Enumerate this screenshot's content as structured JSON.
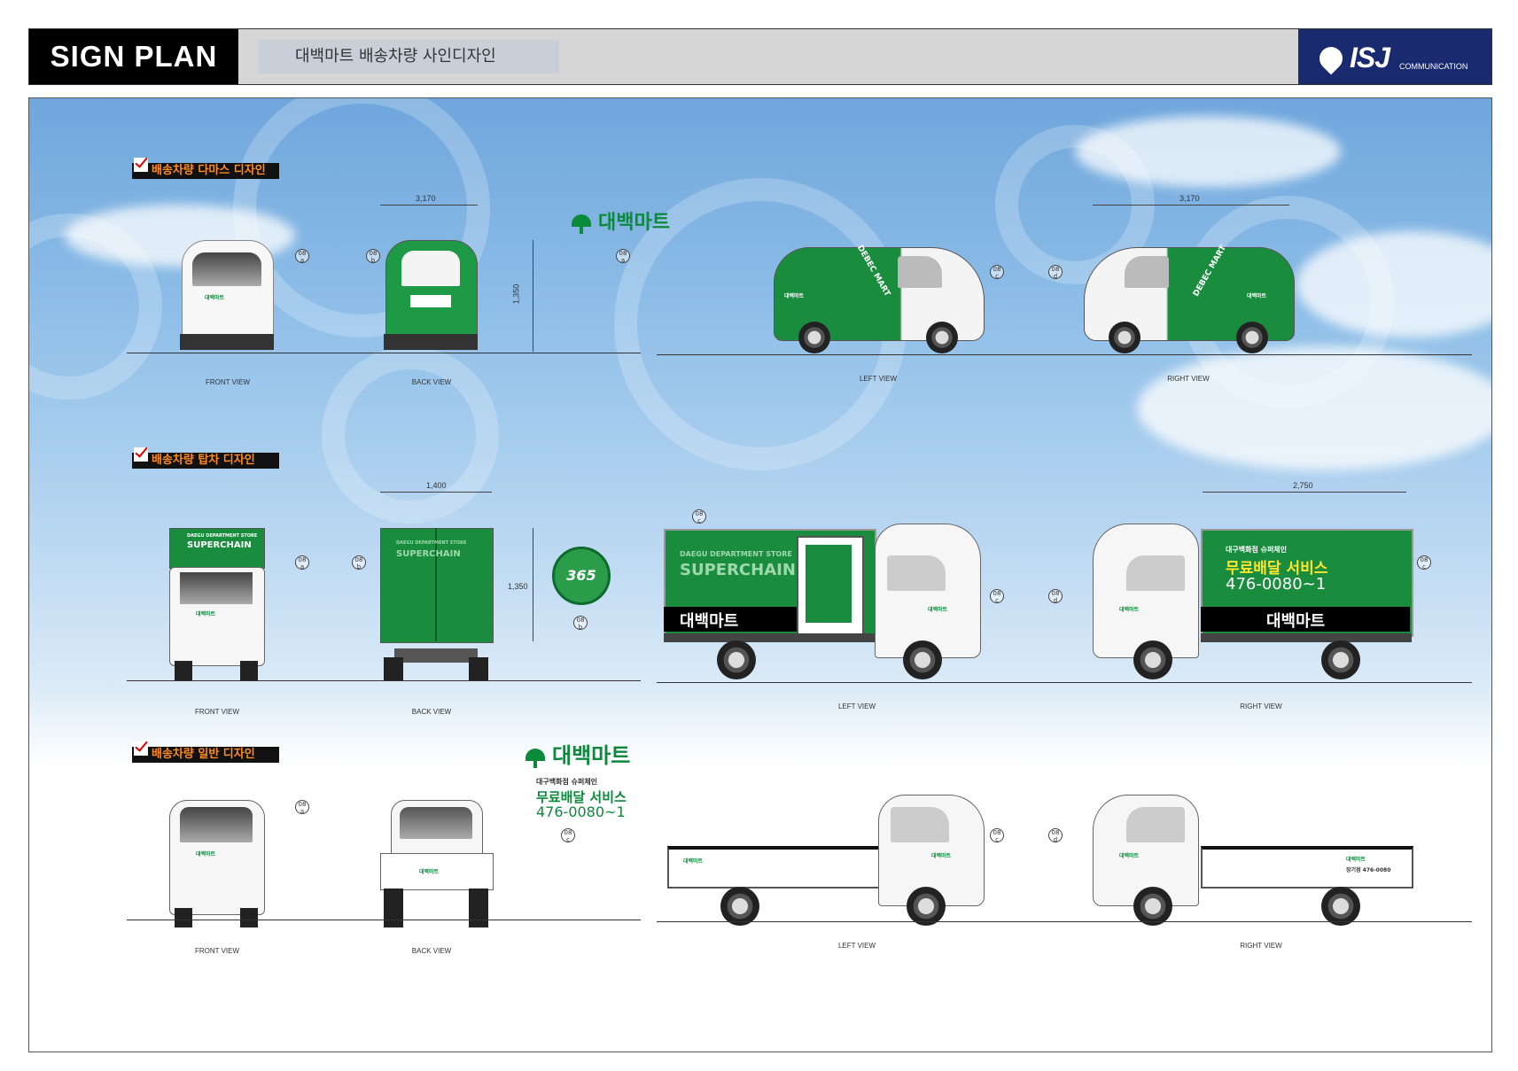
{
  "header": {
    "title": "SIGN PLAN",
    "subtitle": "대백마트 배송차량 사인디자인",
    "logo_text": "ISJ",
    "logo_sub": "COMMUNICATION",
    "logo_bg": "#1a2a6e"
  },
  "brand": {
    "name": "대백마트",
    "color": "#0b8a3c",
    "promo_small": "대구백화점 슈퍼체인",
    "promo_service": "무료배달 서비스",
    "promo_phone": "476-0080~1",
    "box_store": "DAEGU DEPARTMENT STORE",
    "box_chain": "SUPERCHAIN",
    "badge": "365",
    "van_side": "DEBEC MART",
    "truck_phone_small": "장기점 476-0080"
  },
  "sections": [
    {
      "heading": "배송차량 다마스 디자인",
      "views": [
        "FRONT VIEW",
        "BACK VIEW",
        "LEFT VIEW",
        "RIGHT VIEW"
      ],
      "dims": {
        "width_back": "3,170",
        "width_side": "3,170",
        "height": "1,350"
      }
    },
    {
      "heading": "배송차량 탑차 디자인",
      "views": [
        "FRONT VIEW",
        "BACK VIEW",
        "LEFT VIEW",
        "RIGHT VIEW"
      ],
      "dims": {
        "width_back": "1,400",
        "width_side": "2,750",
        "height": "1,350"
      }
    },
    {
      "heading": "배송차량 일반 디자인",
      "views": [
        "FRONT VIEW",
        "BACK VIEW",
        "LEFT VIEW",
        "RIGHT VIEW"
      ]
    }
  ],
  "callouts": {
    "a": "08 a",
    "b": "08 b",
    "c": "08 c",
    "d": "08 d"
  }
}
